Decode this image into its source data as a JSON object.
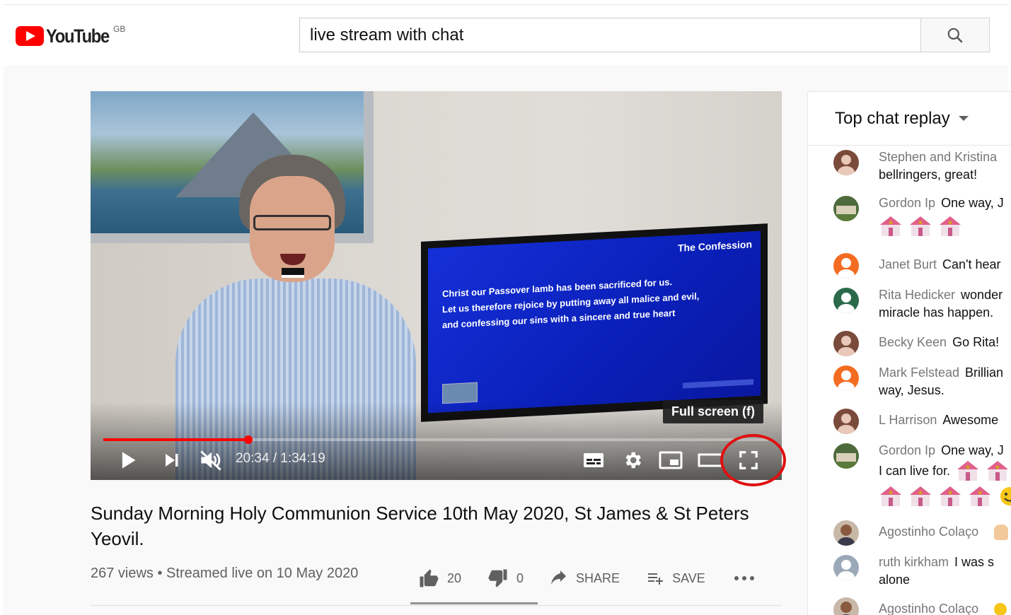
{
  "header": {
    "logo_text": "YouTube",
    "region": "GB",
    "search_value": "live stream with chat"
  },
  "video": {
    "time": "20:34 / 1:34:19",
    "progress": 0.218,
    "tooltip": "Full screen (f)",
    "tv_title": "The Confession",
    "tv_lines": [
      "Christ our Passover lamb has been sacrificed for us.",
      "Let us therefore rejoice by putting away all malice and evil,",
      "and confessing our sins with a sincere and true heart"
    ]
  },
  "info": {
    "title": "Sunday Morning Holy Communion Service 10th May 2020, St James & St Peters Yeovil.",
    "meta": "267 views • Streamed live on 10 May 2020",
    "likes": "20",
    "dislikes": "0",
    "share_label": "SHARE",
    "save_label": "SAVE"
  },
  "chat": {
    "header": "Top chat replay",
    "messages": [
      {
        "name": "Stephen and Kristina",
        "text": "",
        "line2": "bellringers, great!",
        "avatar_color": "#7a4a3a"
      },
      {
        "name": "Gordon Ip",
        "text": "One way, J",
        "line2": "",
        "avatar_color": "#4d6a3a"
      },
      {
        "name": "Janet Burt",
        "text": "Can't hear",
        "line2": "",
        "avatar_color": "#f36c21"
      },
      {
        "name": "Rita Hedicker",
        "text": "wonder",
        "line2": "miracle has happen. ",
        "avatar_color": "#2a6a4a"
      },
      {
        "name": "Becky Keen",
        "text": "Go Rita!",
        "line2": "",
        "avatar_color": "#7a4a3a"
      },
      {
        "name": "Mark Felstead",
        "text": "Brillian",
        "line2": "way, Jesus.",
        "avatar_color": "#f36c21"
      },
      {
        "name": "L Harrison",
        "text": "Awesome",
        "line2": "",
        "avatar_color": "#7a4a3a"
      },
      {
        "name": "Gordon Ip",
        "text": "One way, J",
        "line2": "I can live for.",
        "avatar_color": "#4d6a3a"
      },
      {
        "name": "Agostinho Colaço",
        "text": "",
        "line2": "",
        "avatar_color": "#8a5a40"
      },
      {
        "name": "ruth kirkham",
        "text": "I was s",
        "line2": "alone",
        "avatar_color": "#9aa8b8"
      },
      {
        "name": "Agostinho Colaço",
        "text": "",
        "line2": "",
        "avatar_color": "#8a5a40"
      }
    ]
  }
}
